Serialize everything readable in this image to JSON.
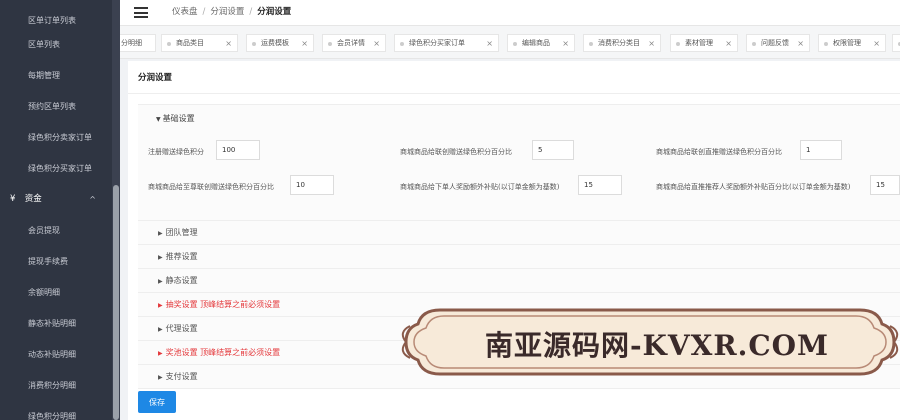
{
  "sidebar": {
    "items_top": [
      {
        "label": "区单订单列表"
      },
      {
        "label": "区单列表"
      },
      {
        "label": "每期管理"
      },
      {
        "label": "预约区单列表"
      },
      {
        "label": "绿色积分卖家订单"
      },
      {
        "label": "绿色积分买家订单"
      }
    ],
    "group": {
      "icon": "yen-icon",
      "icon_glyph": "¥",
      "label": "资金",
      "chevron": "^"
    },
    "items_bottom": [
      {
        "label": "会员提现"
      },
      {
        "label": "提现手续费"
      },
      {
        "label": "余额明细"
      },
      {
        "label": "静态补贴明细"
      },
      {
        "label": "动态补贴明细"
      },
      {
        "label": "消费积分明细"
      },
      {
        "label": "绿色积分明细"
      }
    ]
  },
  "header": {
    "breadcrumb": [
      "仪表盘",
      "分润设置",
      "分润设置"
    ]
  },
  "tabs": [
    {
      "label": "分明细"
    },
    {
      "label": "商品类目"
    },
    {
      "label": "运费模板"
    },
    {
      "label": "会员详情"
    },
    {
      "label": "绿色积分买家订单"
    },
    {
      "label": "编辑商品"
    },
    {
      "label": "消费积分类目"
    },
    {
      "label": "素材管理"
    },
    {
      "label": "问题反馈"
    },
    {
      "label": "权限管理"
    }
  ],
  "panel": {
    "title": "分润设置",
    "basic_section": {
      "title": "基础设置",
      "fields": [
        {
          "label": "注册赠送绿色积分",
          "value": "100"
        },
        {
          "label": "商城商品给联创赠送绿色积分百分比",
          "value": "5"
        },
        {
          "label": "商城商品给联创直推赠送绿色积分百分比",
          "value": "1"
        },
        {
          "label": "商城商品给至尊联创赠送绿色积分百分比",
          "value": "10"
        },
        {
          "label": "商城商品给下单人奖励额外补贴(以订单金额为基数)",
          "value": "15"
        },
        {
          "label": "商城商品给直推推荐人奖励额外补贴百分比(以订单金额为基数)",
          "value": "15"
        }
      ]
    },
    "collapsed_sections": [
      {
        "label": "团队管理",
        "red": false
      },
      {
        "label": "推荐设置",
        "red": false
      },
      {
        "label": "静态设置",
        "red": false
      },
      {
        "label": "抽奖设置 顶峰结算之前必须设置",
        "red": true
      },
      {
        "label": "代理设置",
        "red": false
      },
      {
        "label": "奖池设置 顶峰结算之前必须设置",
        "red": true
      },
      {
        "label": "支付设置",
        "red": false
      }
    ],
    "save_label": "保存"
  },
  "watermark": {
    "text": "南亚源码网-KVXR.COM"
  }
}
